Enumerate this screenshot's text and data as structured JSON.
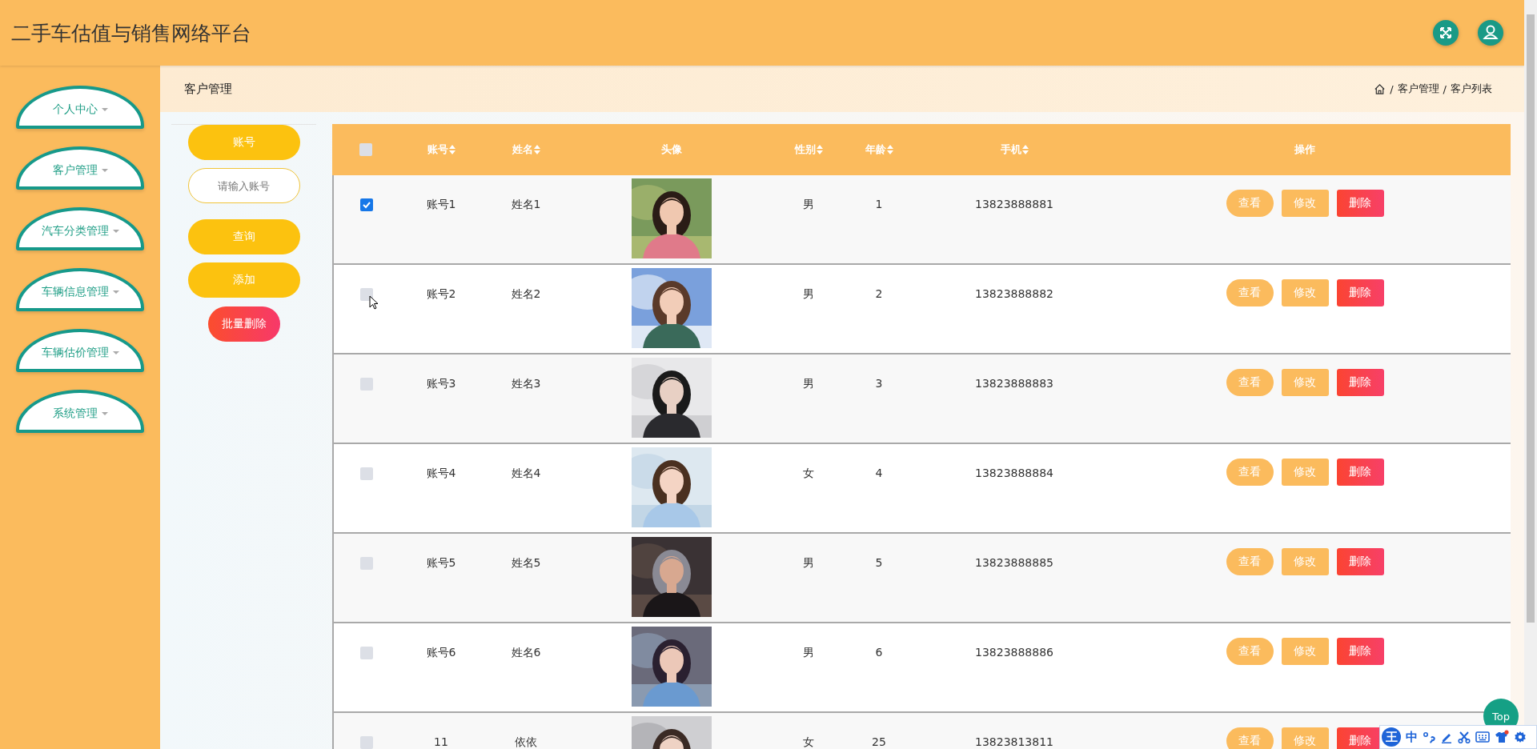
{
  "header": {
    "title": "二手车估值与销售网络平台"
  },
  "sidebar": {
    "items": [
      {
        "label": "个人中心"
      },
      {
        "label": "客户管理"
      },
      {
        "label": "汽车分类管理"
      },
      {
        "label": "车辆信息管理"
      },
      {
        "label": "车辆估价管理"
      },
      {
        "label": "系统管理"
      }
    ]
  },
  "breadcrumb": {
    "page_title": "客户管理",
    "separator": "/",
    "trail": [
      "客户管理",
      "客户列表"
    ]
  },
  "search": {
    "field_label": "账号",
    "placeholder": "请输入账号",
    "buttons": [
      {
        "label": "查询",
        "kind": "primary"
      },
      {
        "label": "添加",
        "kind": "primary"
      },
      {
        "label": "批量删除",
        "kind": "danger"
      }
    ]
  },
  "table": {
    "columns": [
      {
        "kind": "checkbox",
        "checked": false
      },
      {
        "kind": "text",
        "label": "账号",
        "sortable": true
      },
      {
        "kind": "text",
        "label": "姓名",
        "sortable": true
      },
      {
        "kind": "text",
        "label": "头像",
        "sortable": false
      },
      {
        "kind": "text",
        "label": "性别",
        "sortable": true
      },
      {
        "kind": "text",
        "label": "年龄",
        "sortable": true
      },
      {
        "kind": "text",
        "label": "手机",
        "sortable": true
      },
      {
        "kind": "text",
        "label": "操作",
        "sortable": false
      }
    ],
    "rows": [
      {
        "checked": true,
        "account": "账号1",
        "name": "姓名1",
        "gender": "男",
        "age": "1",
        "phone": "13823888881",
        "actions": [
          {
            "kind": "view",
            "label": "查看"
          },
          {
            "kind": "edit",
            "label": "修改"
          },
          {
            "kind": "delete",
            "label": "删除"
          }
        ]
      },
      {
        "checked": false,
        "account": "账号2",
        "name": "姓名2",
        "gender": "男",
        "age": "2",
        "phone": "13823888882",
        "actions": [
          {
            "kind": "view",
            "label": "查看"
          },
          {
            "kind": "edit",
            "label": "修改"
          },
          {
            "kind": "delete",
            "label": "删除"
          }
        ]
      },
      {
        "checked": false,
        "account": "账号3",
        "name": "姓名3",
        "gender": "男",
        "age": "3",
        "phone": "13823888883",
        "actions": [
          {
            "kind": "view",
            "label": "查看"
          },
          {
            "kind": "edit",
            "label": "修改"
          },
          {
            "kind": "delete",
            "label": "删除"
          }
        ]
      },
      {
        "checked": false,
        "account": "账号4",
        "name": "姓名4",
        "gender": "女",
        "age": "4",
        "phone": "13823888884",
        "actions": [
          {
            "kind": "view",
            "label": "查看"
          },
          {
            "kind": "edit",
            "label": "修改"
          },
          {
            "kind": "delete",
            "label": "删除"
          }
        ]
      },
      {
        "checked": false,
        "account": "账号5",
        "name": "姓名5",
        "gender": "男",
        "age": "5",
        "phone": "13823888885",
        "actions": [
          {
            "kind": "view",
            "label": "查看"
          },
          {
            "kind": "edit",
            "label": "修改"
          },
          {
            "kind": "delete",
            "label": "删除"
          }
        ]
      },
      {
        "checked": false,
        "account": "账号6",
        "name": "姓名6",
        "gender": "男",
        "age": "6",
        "phone": "13823888886",
        "actions": [
          {
            "kind": "view",
            "label": "查看"
          },
          {
            "kind": "edit",
            "label": "修改"
          },
          {
            "kind": "delete",
            "label": "删除"
          }
        ]
      },
      {
        "checked": false,
        "account": "11",
        "name": "依依",
        "gender": "女",
        "age": "25",
        "phone": "13823813811",
        "actions": [
          {
            "kind": "view",
            "label": "查看"
          },
          {
            "kind": "edit",
            "label": "修改"
          },
          {
            "kind": "delete",
            "label": "删除"
          }
        ]
      }
    ]
  },
  "top_button": {
    "label": "Top"
  },
  "ime_toolbar": {
    "items": [
      {
        "kind": "logo",
        "label": "王"
      },
      {
        "kind": "text",
        "label": "中"
      },
      {
        "kind": "punctuation"
      },
      {
        "kind": "pen"
      },
      {
        "kind": "scissors"
      },
      {
        "kind": "keyboard"
      },
      {
        "kind": "shirt"
      },
      {
        "kind": "gear"
      }
    ]
  }
}
